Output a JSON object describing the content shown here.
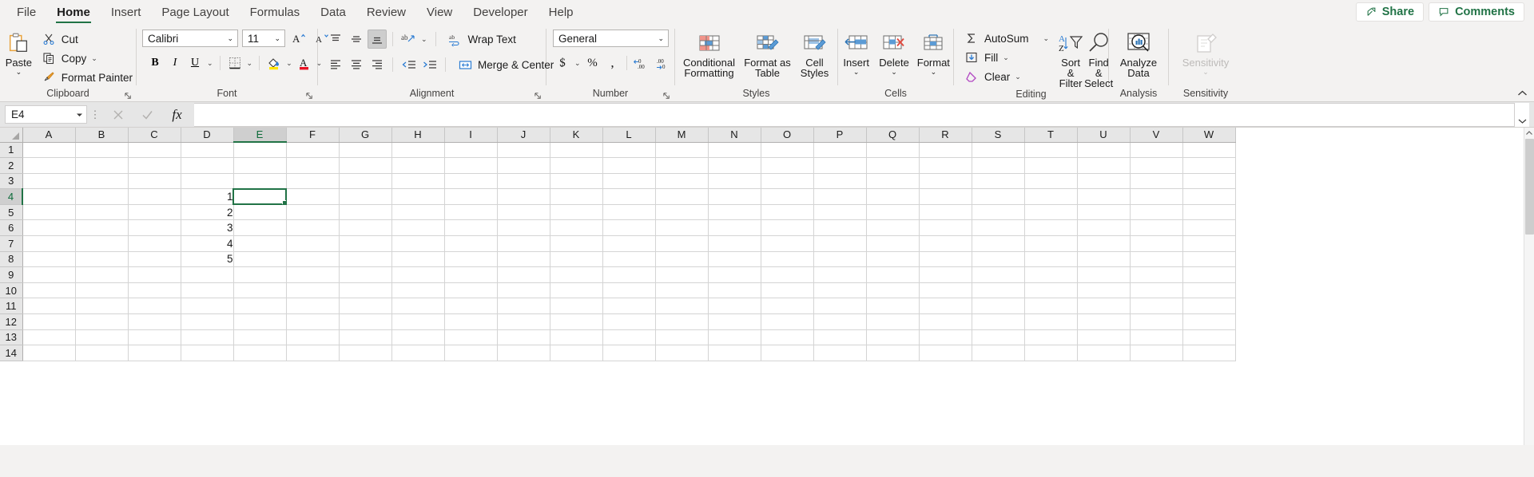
{
  "tabs": [
    {
      "label": "File",
      "active": false
    },
    {
      "label": "Home",
      "active": true
    },
    {
      "label": "Insert",
      "active": false
    },
    {
      "label": "Page Layout",
      "active": false
    },
    {
      "label": "Formulas",
      "active": false
    },
    {
      "label": "Data",
      "active": false
    },
    {
      "label": "Review",
      "active": false
    },
    {
      "label": "View",
      "active": false
    },
    {
      "label": "Developer",
      "active": false
    },
    {
      "label": "Help",
      "active": false
    }
  ],
  "titlebar": {
    "share_label": "Share",
    "comments_label": "Comments"
  },
  "ribbon": {
    "clipboard": {
      "label": "Clipboard",
      "paste": "Paste",
      "cut": "Cut",
      "copy": "Copy",
      "format_painter": "Format Painter"
    },
    "font": {
      "label": "Font",
      "font_name": "Calibri",
      "font_size": "11",
      "bold": "B",
      "italic": "I",
      "underline": "U"
    },
    "alignment": {
      "label": "Alignment",
      "wrap_text": "Wrap Text",
      "merge_center": "Merge & Center"
    },
    "number": {
      "label": "Number",
      "format": "General"
    },
    "styles": {
      "label": "Styles",
      "conditional_formatting": "Conditional Formatting",
      "format_as_table": "Format as Table",
      "cell_styles": "Cell Styles"
    },
    "cells": {
      "label": "Cells",
      "insert": "Insert",
      "delete": "Delete",
      "format": "Format"
    },
    "editing": {
      "label": "Editing",
      "autosum": "AutoSum",
      "fill": "Fill",
      "clear": "Clear",
      "sort_filter": "Sort & Filter",
      "find_select": "Find & Select"
    },
    "analysis": {
      "label": "Analysis",
      "analyze_data": "Analyze Data"
    },
    "sensitivity": {
      "label": "Sensitivity",
      "sensitivity": "Sensitivity"
    }
  },
  "formula_bar": {
    "name_box": "E4",
    "formula": "",
    "formula_placeholder": ""
  },
  "grid": {
    "columns": [
      "A",
      "B",
      "C",
      "D",
      "E",
      "F",
      "G",
      "H",
      "I",
      "J",
      "K",
      "L",
      "M",
      "N",
      "O",
      "P",
      "Q",
      "R",
      "S",
      "T",
      "U",
      "V",
      "W"
    ],
    "active_column": "E",
    "active_row": 4,
    "rows": [
      1,
      2,
      3,
      4,
      5,
      6,
      7,
      8,
      9,
      10,
      11,
      12,
      13,
      14
    ],
    "selected_cell": "E4",
    "cells": {
      "D4": "1",
      "D5": "2",
      "D6": "3",
      "D7": "4",
      "D8": "5"
    }
  },
  "colors": {
    "accent_green": "#217346",
    "ribbon_bg": "#f3f2f1",
    "grid_line": "#d4d4d4",
    "header_bg": "#e6e6e6"
  }
}
